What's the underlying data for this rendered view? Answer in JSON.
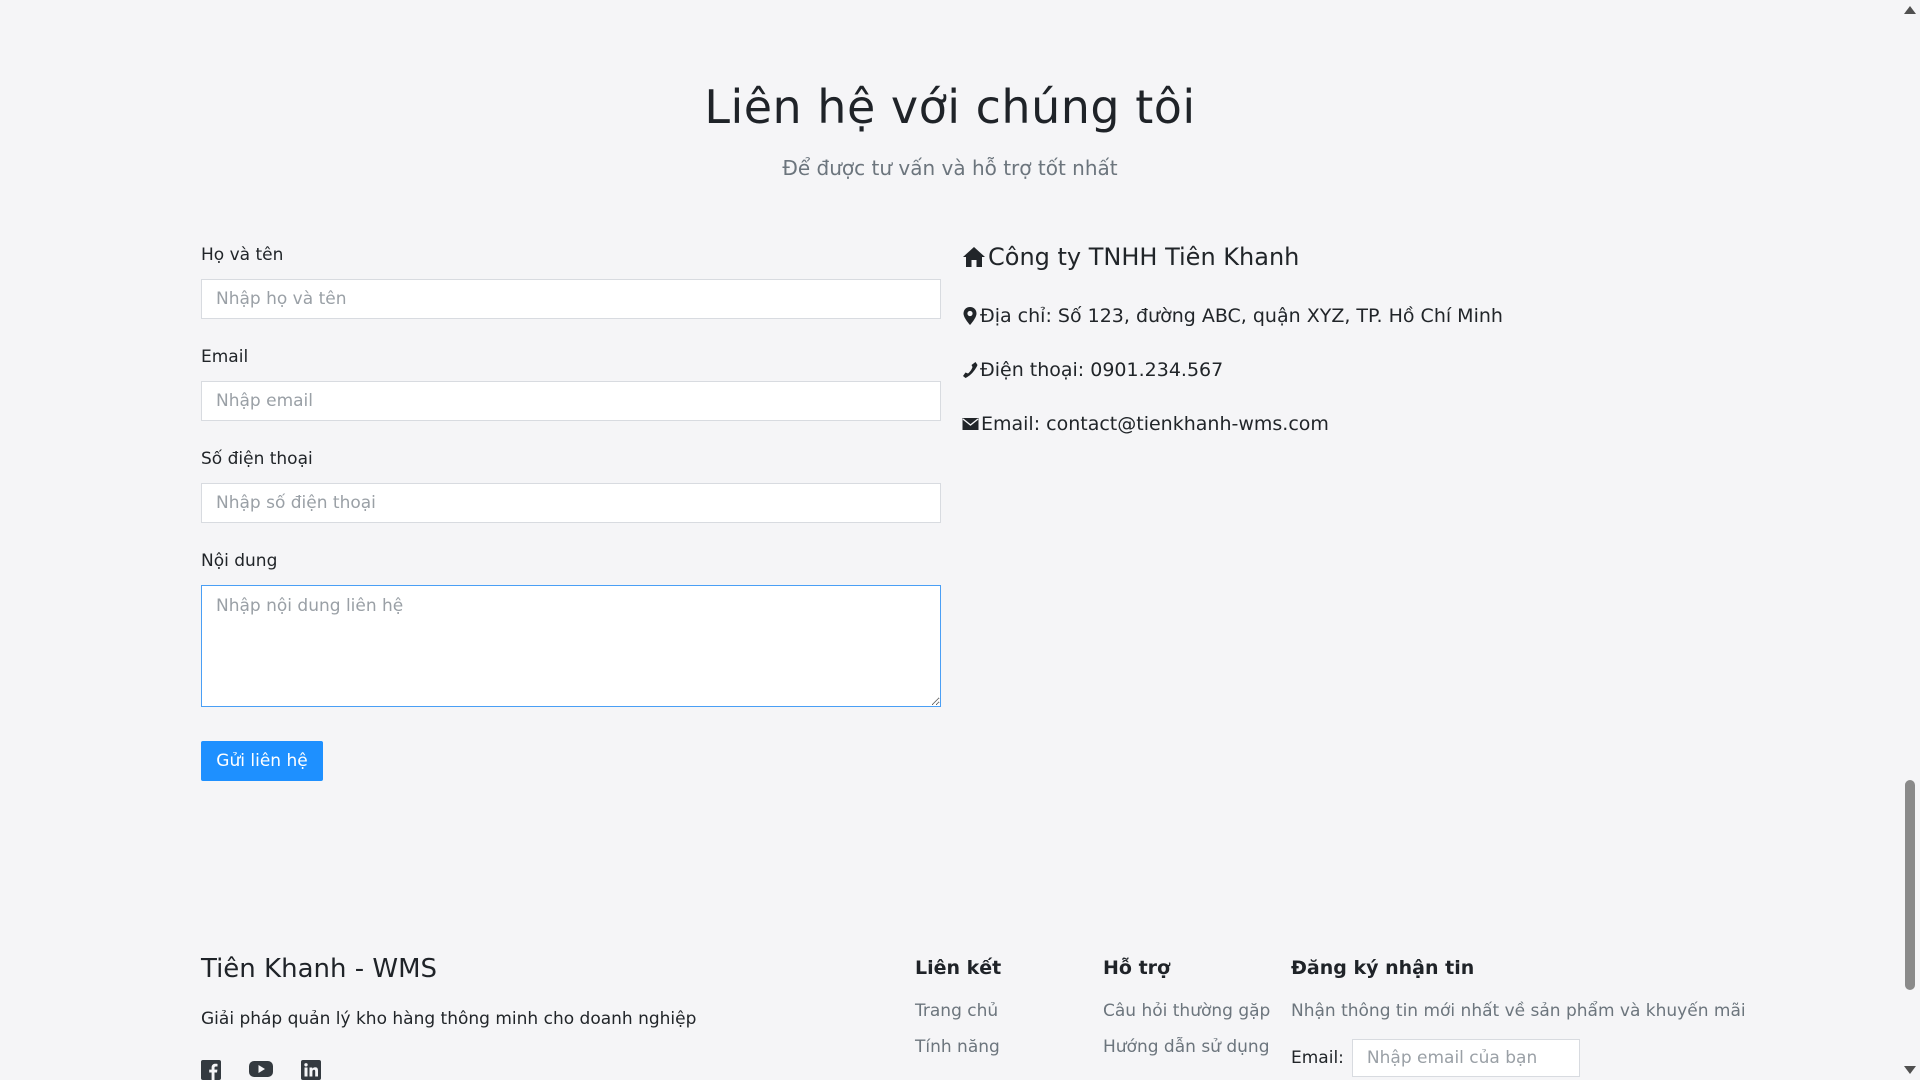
{
  "hero": {
    "title": "Liên hệ với chúng tôi",
    "subtitle": "Để được tư vấn và hỗ trợ tốt nhất"
  },
  "form": {
    "name_label": "Họ và tên",
    "name_placeholder": "Nhập họ và tên",
    "email_label": "Email",
    "email_placeholder": "Nhập email",
    "phone_label": "Số điện thoại",
    "phone_placeholder": "Nhập số điện thoại",
    "message_label": "Nội dung",
    "message_placeholder": "Nhập nội dung liên hệ",
    "submit_label": "Gửi liên hệ"
  },
  "company": {
    "name": "Công ty TNHH Tiên Khanh",
    "address": "Địa chỉ: Số 123, đường ABC, quận XYZ, TP. Hồ Chí Minh",
    "phone": "Điện thoại: 0901.234.567",
    "email": "Email: contact@tienkhanh-wms.com",
    "icons": [
      "home-icon",
      "map-pin-icon",
      "phone-icon",
      "envelope-icon"
    ]
  },
  "footer": {
    "brand": "Tiên Khanh - WMS",
    "tagline": "Giải pháp quản lý kho hàng thông minh cho doanh nghiệp",
    "social_icons": [
      "facebook-icon",
      "youtube-icon",
      "linkedin-icon"
    ],
    "links": {
      "title": "Liên kết",
      "items": [
        "Trang chủ",
        "Tính năng"
      ]
    },
    "support": {
      "title": "Hỗ trợ",
      "items": [
        "Câu hỏi thường gặp",
        "Hướng dẫn sử dụng"
      ]
    },
    "newsletter": {
      "title": "Đăng ký nhận tin",
      "description": "Nhận thông tin mới nhất về sản phẩm và khuyến mãi",
      "email_label": "Email:",
      "email_placeholder": "Nhập email của bạn"
    }
  }
}
